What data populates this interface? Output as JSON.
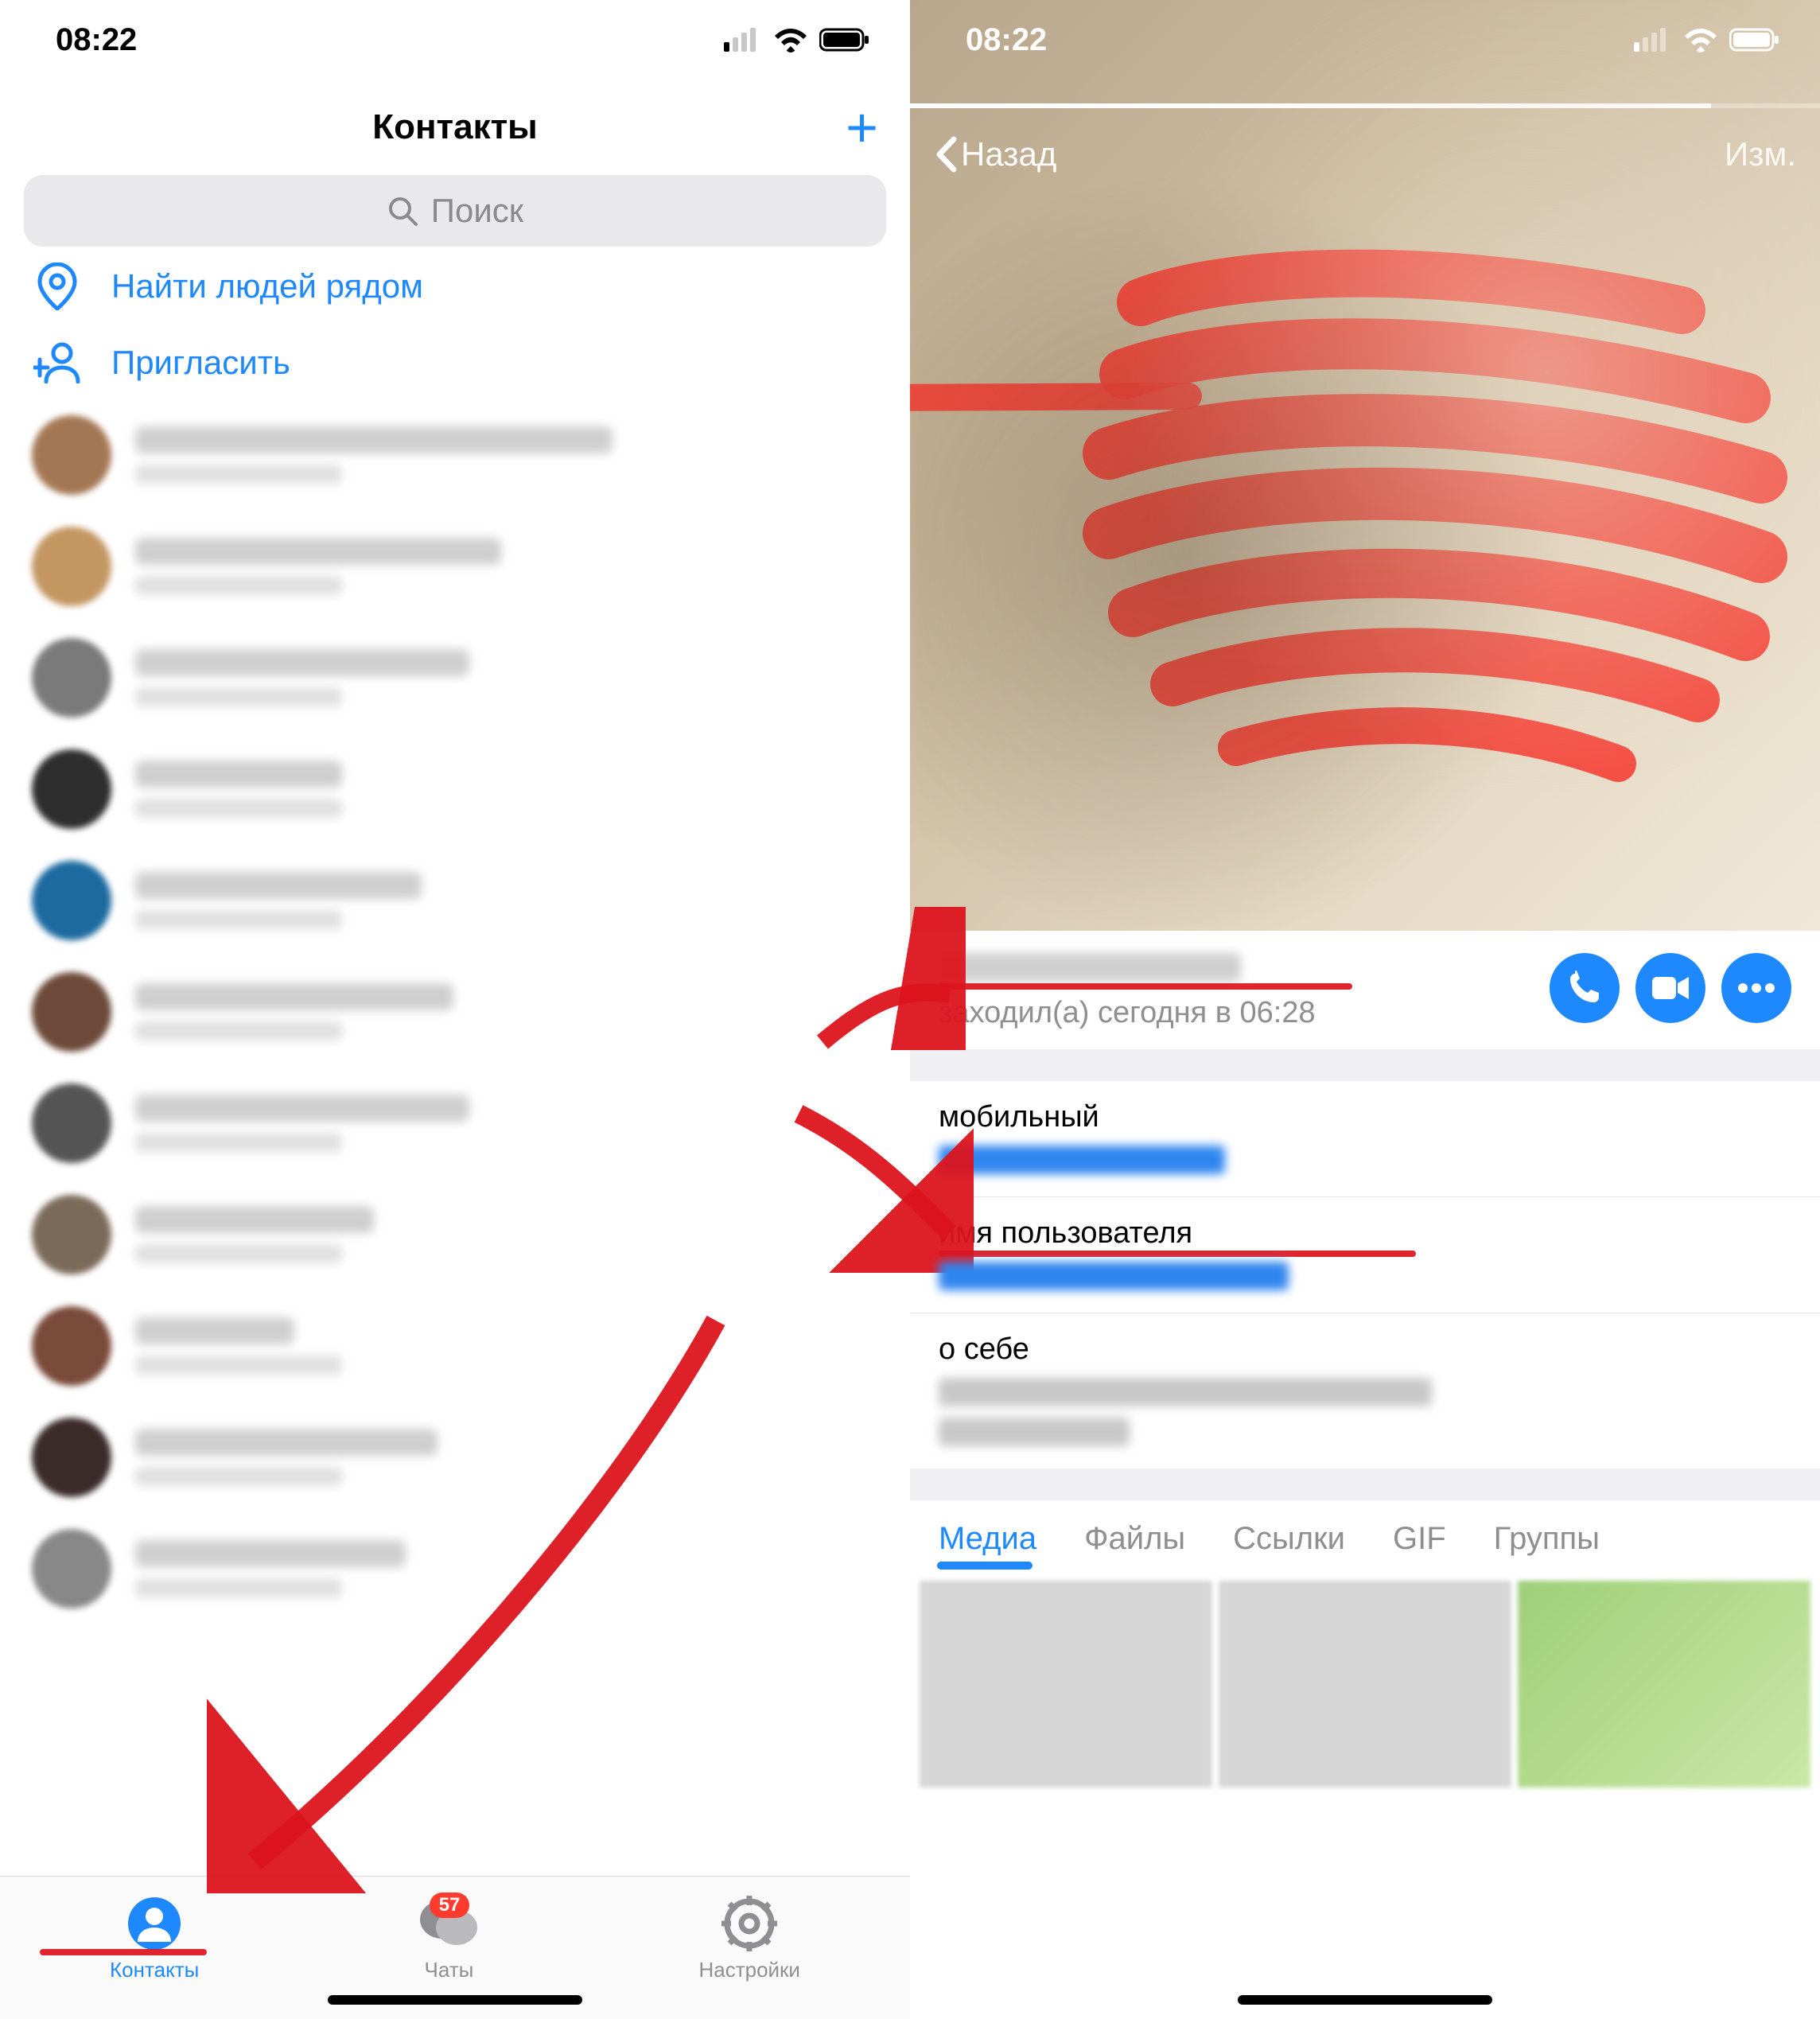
{
  "left": {
    "status_time": "08:22",
    "header_title": "Контакты",
    "search_placeholder": "Поиск",
    "nearby_label": "Найти людей рядом",
    "invite_label": "Пригласить",
    "tabs": {
      "contacts": "Контакты",
      "chats": "Чаты",
      "chats_badge": "57",
      "settings": "Настройки"
    }
  },
  "right": {
    "status_time": "08:22",
    "back_label": "Назад",
    "edit_label": "Изм.",
    "last_seen": "заходил(а) сегодня в 06:28",
    "mobile_label": "мобильный",
    "username_label": "имя пользователя",
    "bio_label": "о себе",
    "media_tabs": {
      "media": "Медиа",
      "files": "Файлы",
      "links": "Ссылки",
      "gif": "GIF",
      "groups": "Группы"
    }
  }
}
